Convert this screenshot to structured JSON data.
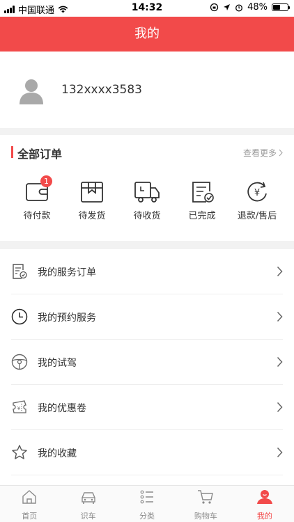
{
  "status_bar": {
    "carrier": "中国联通",
    "time": "14:32",
    "battery": "48%",
    "battery_level": 0.48
  },
  "navbar": {
    "title": "我的"
  },
  "profile": {
    "phone": "132xxxx3583",
    "avatar_icon": "user-avatar-icon"
  },
  "orders": {
    "title": "全部订单",
    "more_label": "查看更多",
    "items": [
      {
        "label": "待付款",
        "icon": "wallet-icon",
        "badge": "1"
      },
      {
        "label": "待发货",
        "icon": "package-icon"
      },
      {
        "label": "待收货",
        "icon": "truck-icon"
      },
      {
        "label": "已完成",
        "icon": "completed-doc-icon"
      },
      {
        "label": "退款/售后",
        "icon": "refund-icon"
      }
    ]
  },
  "menu": [
    {
      "label": "我的服务订单",
      "icon": "service-order-icon"
    },
    {
      "label": "我的预约服务",
      "icon": "clock-icon"
    },
    {
      "label": "我的试驾",
      "icon": "steering-wheel-icon"
    },
    {
      "label": "我的优惠卷",
      "icon": "coupon-icon"
    },
    {
      "label": "我的收藏",
      "icon": "star-icon"
    }
  ],
  "tabbar": {
    "items": [
      {
        "label": "首页",
        "icon": "home-icon"
      },
      {
        "label": "识车",
        "icon": "car-icon"
      },
      {
        "label": "分类",
        "icon": "list-icon"
      },
      {
        "label": "购物车",
        "icon": "cart-icon"
      },
      {
        "label": "我的",
        "icon": "profile-icon",
        "active": true
      }
    ]
  },
  "colors": {
    "accent": "#f24a4a",
    "separator": "#f2f2f2",
    "muted": "#999999"
  }
}
